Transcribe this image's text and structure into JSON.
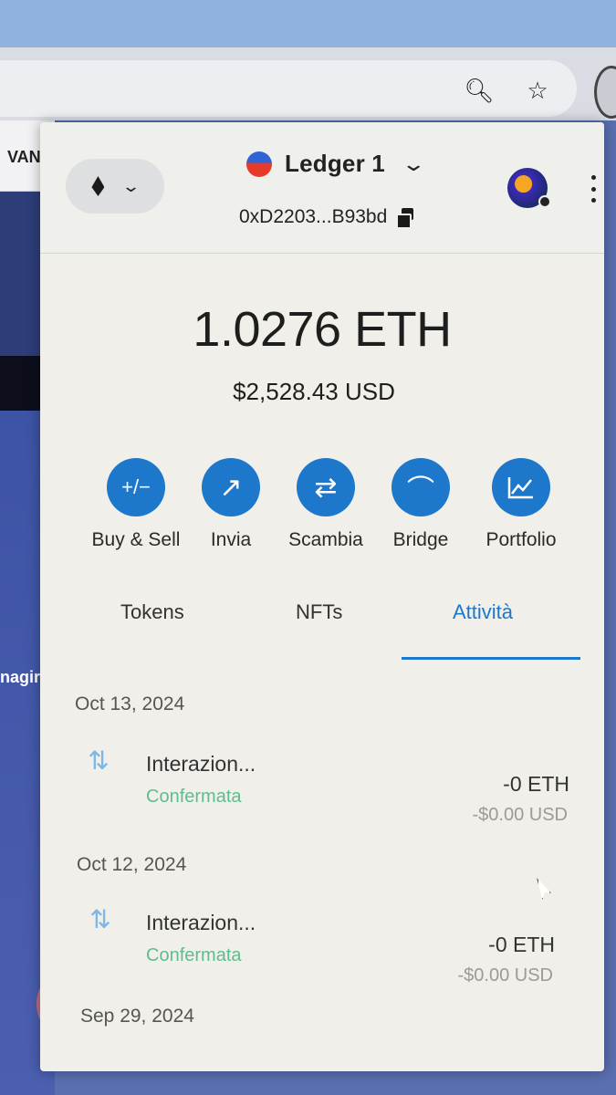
{
  "browser": {
    "search_icon": "magnifier-icon",
    "bookmark_icon": "star-icon",
    "page_text_top": "VAN",
    "page_text_side": "nagir"
  },
  "wallet": {
    "network_icon": "ethereum-icon",
    "account_name": "Ledger 1",
    "address": "0xD2203...B93bd",
    "balance": "1.0276 ETH",
    "fiat_balance": "$2,528.43 USD",
    "accent": "#1d78cb"
  },
  "actions": [
    {
      "label": "Buy & Sell",
      "icon": "plus-minus-icon",
      "glyph": "+/−"
    },
    {
      "label": "Invia",
      "icon": "arrow-up-right-icon",
      "glyph": "↗"
    },
    {
      "label": "Scambia",
      "icon": "swap-arrows-icon",
      "glyph": "⇄"
    },
    {
      "label": "Bridge",
      "icon": "bridge-icon",
      "glyph": "⌒"
    },
    {
      "label": "Portfolio",
      "icon": "chart-icon",
      "glyph": "📈"
    }
  ],
  "tabs": [
    {
      "label": "Tokens",
      "active": false
    },
    {
      "label": "NFTs",
      "active": false
    },
    {
      "label": "Attività",
      "active": true
    }
  ],
  "activity": [
    {
      "date": "Oct 13, 2024",
      "title": "Interazion...",
      "status": "Confermata",
      "amount": "-0 ETH",
      "fiat": "-$0.00 USD"
    },
    {
      "date": "Oct 12, 2024",
      "title": "Interazion...",
      "status": "Confermata",
      "amount": "-0 ETH",
      "fiat": "-$0.00 USD"
    },
    {
      "date": "Sep 29, 2024"
    }
  ]
}
